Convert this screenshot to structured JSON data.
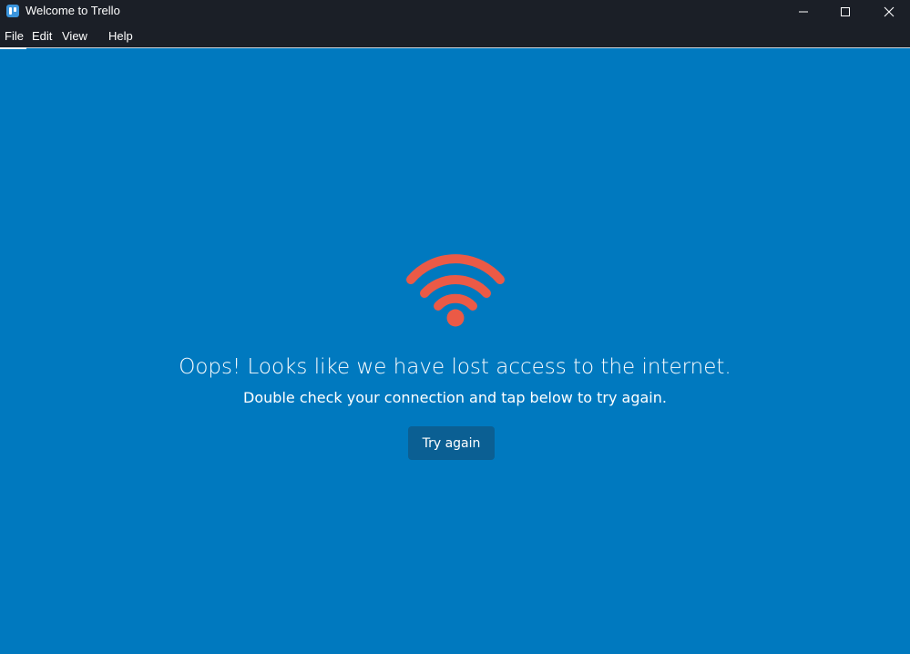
{
  "window": {
    "title": "Welcome to Trello",
    "app_icon": "trello-logo-icon",
    "controls": {
      "minimize_icon": "minimize-icon",
      "maximize_icon": "maximize-icon",
      "close_icon": "close-icon"
    }
  },
  "menubar": {
    "items": [
      {
        "label": "File"
      },
      {
        "label": "Edit"
      },
      {
        "label": "View"
      },
      {
        "label": "Help"
      }
    ],
    "active_index": 0
  },
  "main": {
    "icon": "wifi-icon",
    "headline": "Oops! Looks like we have lost access to the internet.",
    "subline": "Double check your connection and tap below to try again.",
    "retry_button": "Try again"
  },
  "colors": {
    "background": "#0079bf",
    "titlebar": "#1b1f27",
    "wifi_icon": "#eb5a46",
    "button": "#0b5f93",
    "text": "#ffffff"
  }
}
